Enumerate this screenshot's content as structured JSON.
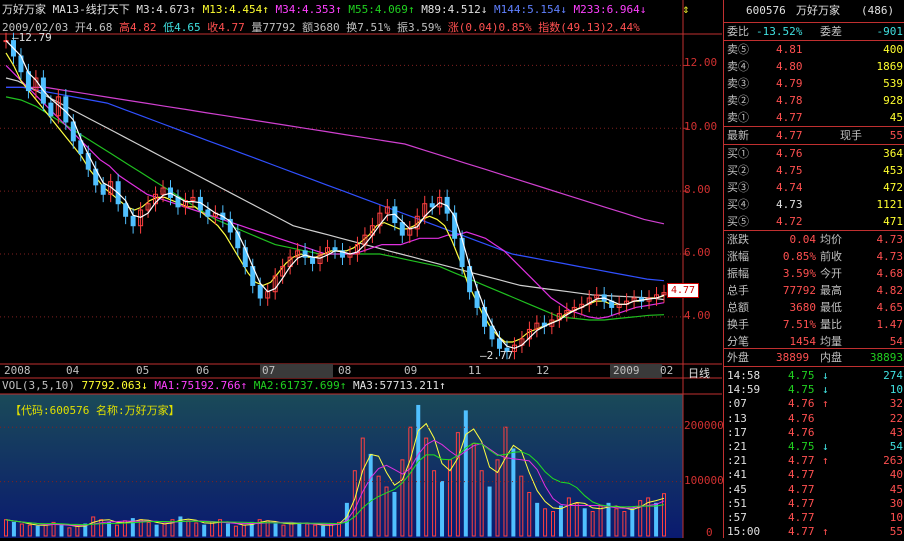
{
  "header": {
    "stock_name": "万好万家",
    "indicator_name": "MA13-线打天下",
    "m3": "M3:4.673",
    "m13": "M13:4.454",
    "m34": "M34:4.353",
    "m55": "M55:4.069",
    "m89": "M89:4.512",
    "m144": "M144:5.154",
    "m233": "M233:6.964"
  },
  "quote_line": {
    "date": "2009/02/03",
    "open": "开4.68",
    "high": "高4.82",
    "low": "低4.65",
    "close": "收4.77",
    "volume": "量77792",
    "amount": "额3680",
    "turnover": "换7.51%",
    "amplitude": "振3.59%",
    "change": "涨(0.04)0.85%",
    "index": "指数(49.13)2.44%"
  },
  "price_axis": [
    "12.00",
    "10.00",
    "8.00",
    "6.00",
    "4.00"
  ],
  "price_marker": "4.77",
  "max_label": "12.79",
  "min_label": "2.77",
  "date_axis": [
    "2008",
    "04",
    "05",
    "06",
    "07",
    "08",
    "09",
    "11",
    "12",
    "2009",
    "02"
  ],
  "period_label": "日线",
  "volume_line": {
    "title": "VOL(3,5,10)",
    "vol": "77792.063",
    "ma1": "MA1:75192.766",
    "ma2": "MA2:61737.699",
    "ma3": "MA3:57713.211"
  },
  "volume_axis": [
    "200000",
    "100000",
    "0"
  ],
  "code_label": "【代码:600576 名称:万好万家】",
  "right_panel": {
    "code": "600576",
    "name": "万好万家",
    "num": "(486)",
    "wb_label": "委比",
    "wb_value": "-13.52%",
    "wc_label": "委差",
    "wc_value": "-901",
    "asks": [
      {
        "label": "卖⑤",
        "price": "4.81",
        "vol": "400"
      },
      {
        "label": "卖④",
        "price": "4.80",
        "vol": "1869"
      },
      {
        "label": "卖③",
        "price": "4.79",
        "vol": "539"
      },
      {
        "label": "卖②",
        "price": "4.78",
        "vol": "928"
      },
      {
        "label": "卖①",
        "price": "4.77",
        "vol": "45"
      }
    ],
    "last_label": "最新",
    "last_price": "4.77",
    "hand_label": "现手",
    "hand_value": "55",
    "bids": [
      {
        "label": "买①",
        "price": "4.76",
        "vol": "364"
      },
      {
        "label": "买②",
        "price": "4.75",
        "vol": "453"
      },
      {
        "label": "买③",
        "price": "4.74",
        "vol": "472"
      },
      {
        "label": "买④",
        "price": "4.73",
        "vol": "1121"
      },
      {
        "label": "买⑤",
        "price": "4.72",
        "vol": "471"
      }
    ],
    "stats": [
      {
        "l1": "涨跌",
        "v1": "0.04",
        "l2": "均价",
        "v2": "4.73"
      },
      {
        "l1": "涨幅",
        "v1": "0.85%",
        "l2": "前收",
        "v2": "4.73"
      },
      {
        "l1": "振幅",
        "v1": "3.59%",
        "l2": "今开",
        "v2": "4.68"
      },
      {
        "l1": "总手",
        "v1": "77792",
        "l2": "最高",
        "v2": "4.82"
      },
      {
        "l1": "总额",
        "v1": "3680",
        "l2": "最低",
        "v2": "4.65"
      },
      {
        "l1": "换手",
        "v1": "7.51%",
        "l2": "量比",
        "v2": "1.47"
      },
      {
        "l1": "分笔",
        "v1": "1454",
        "l2": "均量",
        "v2": "54"
      }
    ],
    "outer_label": "外盘",
    "outer_value": "38899",
    "inner_label": "内盘",
    "inner_value": "38893",
    "ticks": [
      {
        "time": "14:58",
        "price": "4.75",
        "dir": "down",
        "vol": "274"
      },
      {
        "time": "14:59",
        "price": "4.75",
        "dir": "down",
        "vol": "10"
      },
      {
        "time": ":07",
        "price": "4.76",
        "dir": "up",
        "vol": "32"
      },
      {
        "time": ":13",
        "price": "4.76",
        "dir": "",
        "vol": "22"
      },
      {
        "time": ":17",
        "price": "4.76",
        "dir": "",
        "vol": "43"
      },
      {
        "time": ":21",
        "price": "4.75",
        "dir": "down",
        "vol": "54"
      },
      {
        "time": ":21",
        "price": "4.77",
        "dir": "up",
        "vol": "263"
      },
      {
        "time": ":41",
        "price": "4.77",
        "dir": "",
        "vol": "40"
      },
      {
        "time": ":45",
        "price": "4.77",
        "dir": "",
        "vol": "45"
      },
      {
        "time": ":51",
        "price": "4.77",
        "dir": "",
        "vol": "30"
      },
      {
        "time": ":57",
        "price": "4.77",
        "dir": "",
        "vol": "10"
      },
      {
        "time": "15:00",
        "price": "4.77",
        "dir": "up",
        "vol": "55"
      }
    ]
  },
  "chart_data": {
    "type": "line",
    "price_range": [
      2.5,
      13.0
    ],
    "candles": [
      12.79,
      12.3,
      11.8,
      11.2,
      11.6,
      10.8,
      10.4,
      11.0,
      10.2,
      9.6,
      9.2,
      8.7,
      8.2,
      7.9,
      8.3,
      7.6,
      7.2,
      6.9,
      7.4,
      7.6,
      7.9,
      8.1,
      7.8,
      7.5,
      7.7,
      7.8,
      7.4,
      7.2,
      7.3,
      7.1,
      6.7,
      6.2,
      5.6,
      5.0,
      4.6,
      4.8,
      5.3,
      5.6,
      5.9,
      6.1,
      5.9,
      5.7,
      6.0,
      6.2,
      6.1,
      5.9,
      6.0,
      6.3,
      6.6,
      6.9,
      7.3,
      7.5,
      7.0,
      6.6,
      6.8,
      7.2,
      7.6,
      7.5,
      7.8,
      7.3,
      6.5,
      5.6,
      4.8,
      4.3,
      3.7,
      3.3,
      3.0,
      2.9,
      3.1,
      3.3,
      3.6,
      3.8,
      3.7,
      3.9,
      4.1,
      4.2,
      4.3,
      4.4,
      4.6,
      4.7,
      4.5,
      4.3,
      4.4,
      4.5,
      4.6,
      4.5,
      4.6,
      4.7,
      4.77
    ],
    "ma_short": [
      12.4,
      12.0,
      11.5,
      11.2,
      10.9,
      10.6,
      10.3,
      10.0,
      9.7,
      9.4,
      9.1,
      8.7,
      8.4,
      8.1,
      7.9,
      7.7,
      7.5,
      7.4,
      7.5,
      7.7,
      7.8,
      7.8,
      7.7,
      7.6,
      7.5,
      7.5,
      7.3,
      7.1,
      6.9,
      6.6,
      6.2,
      5.8,
      5.4,
      5.1,
      5.0,
      5.1,
      5.4,
      5.7,
      5.9,
      6.0,
      5.9,
      5.9,
      6.0,
      6.1,
      6.1,
      6.1,
      6.2,
      6.4,
      6.6,
      6.9,
      7.0,
      6.9,
      6.8,
      6.8,
      6.9,
      7.1,
      7.2,
      7.1,
      6.9,
      6.4,
      5.8,
      5.1,
      4.6,
      4.1,
      3.7,
      3.4,
      3.2,
      3.2,
      3.3,
      3.5,
      3.6,
      3.7,
      3.8,
      3.9,
      4.1,
      4.2,
      4.3,
      4.4,
      4.5,
      4.5,
      4.4,
      4.4,
      4.4,
      4.5,
      4.5,
      4.6,
      4.6,
      4.67
    ],
    "ma_mid": [
      12.0,
      11.7,
      11.4,
      11.1,
      10.8,
      10.5,
      10.2,
      9.9,
      9.6,
      9.3,
      9.0,
      8.8,
      8.5,
      8.3,
      8.1,
      7.9,
      7.8,
      7.7,
      7.6,
      7.5,
      7.4,
      7.3,
      7.2,
      7.1,
      7.0,
      6.9,
      6.8,
      6.7,
      6.6,
      6.5,
      6.4,
      6.3,
      6.2,
      6.1,
      6.0,
      6.0,
      6.0,
      6.0,
      6.1,
      6.2,
      6.3,
      6.3,
      6.3,
      6.4,
      6.5,
      6.5,
      6.5,
      6.6,
      6.6,
      6.7,
      6.6,
      6.5,
      6.3,
      6.1,
      5.8,
      5.5,
      5.2,
      4.9,
      4.6,
      4.4,
      4.2,
      4.1,
      4.0,
      3.95,
      4.0,
      4.1,
      4.2,
      4.3,
      4.35,
      4.4,
      4.45
    ],
    "ma_long1": [
      11.6,
      11.5,
      11.3,
      11.1,
      10.9,
      10.7,
      10.5,
      10.3,
      10.1,
      9.9,
      9.7,
      9.5,
      9.3,
      9.1,
      8.9,
      8.7,
      8.5,
      8.3,
      8.1,
      7.9,
      7.7,
      7.5,
      7.3,
      7.1,
      6.9,
      6.8,
      6.7,
      6.6,
      6.5,
      6.4,
      6.3,
      6.2,
      6.1,
      6.0,
      5.9,
      5.8,
      5.7,
      5.6,
      5.5,
      5.4,
      5.3,
      5.2,
      5.1,
      5.0,
      4.95,
      4.9,
      4.85,
      4.8,
      4.75,
      4.7,
      4.68,
      4.66,
      4.64,
      4.62,
      4.6,
      4.55
    ],
    "ma_long2": [
      11.3,
      11.3,
      11.2,
      11.1,
      11.0,
      10.9,
      10.8,
      10.6,
      10.4,
      10.2,
      10.0,
      9.8,
      9.6,
      9.4,
      9.2,
      9.0,
      8.8,
      8.6,
      8.4,
      8.2,
      8.0,
      7.8,
      7.6,
      7.4,
      7.2,
      7.0,
      6.8,
      6.6,
      6.4,
      6.2,
      6.0,
      5.9,
      5.8,
      5.7,
      5.6,
      5.5,
      5.4,
      5.3,
      5.2,
      5.15
    ],
    "ma_long3": [
      11.3,
      11.3,
      11.3,
      11.2,
      11.1,
      11.0,
      10.9,
      10.8,
      10.7,
      10.6,
      10.5,
      10.4,
      10.3,
      10.2,
      10.1,
      10.0,
      9.9,
      9.8,
      9.7,
      9.6,
      9.5,
      9.3,
      9.1,
      8.9,
      8.7,
      8.5,
      8.3,
      8.1,
      7.9,
      7.7,
      7.5,
      7.3,
      7.1,
      6.96
    ],
    "ma_green": [
      11.0,
      10.9,
      10.7,
      10.4,
      10.1,
      9.8,
      9.5,
      9.2,
      8.9,
      8.6,
      8.3,
      8.0,
      7.7,
      7.4,
      7.1,
      6.9,
      6.7,
      6.5,
      6.3,
      6.2,
      6.1,
      6.0,
      6.0,
      6.0,
      6.0,
      6.0,
      5.9,
      5.8,
      5.7,
      5.6,
      5.4,
      5.2,
      5.0,
      4.8,
      4.6,
      4.4,
      4.2,
      4.0,
      3.95,
      3.9,
      3.9,
      3.95,
      4.0,
      4.05,
      4.07
    ],
    "volume_max": 250000,
    "volumes": [
      30000,
      25000,
      22000,
      20000,
      18000,
      21000,
      25000,
      20000,
      15000,
      18000,
      22000,
      35000,
      30000,
      25000,
      20000,
      28000,
      32000,
      30000,
      25000,
      20000,
      22000,
      30000,
      35000,
      28000,
      24000,
      20000,
      26000,
      30000,
      22000,
      18000,
      20000,
      25000,
      30000,
      28000,
      22000,
      20000,
      25000,
      24000,
      22000,
      20000,
      18000,
      22000,
      25000,
      60000,
      120000,
      180000,
      150000,
      110000,
      90000,
      80000,
      140000,
      200000,
      240000,
      180000,
      120000,
      100000,
      140000,
      190000,
      230000,
      170000,
      120000,
      90000,
      140000,
      200000,
      160000,
      110000,
      80000,
      60000,
      50000,
      45000,
      55000,
      70000,
      60000,
      50000,
      45000,
      55000,
      60000,
      50000,
      45000,
      50000,
      65000,
      70000,
      60000,
      77792
    ]
  }
}
